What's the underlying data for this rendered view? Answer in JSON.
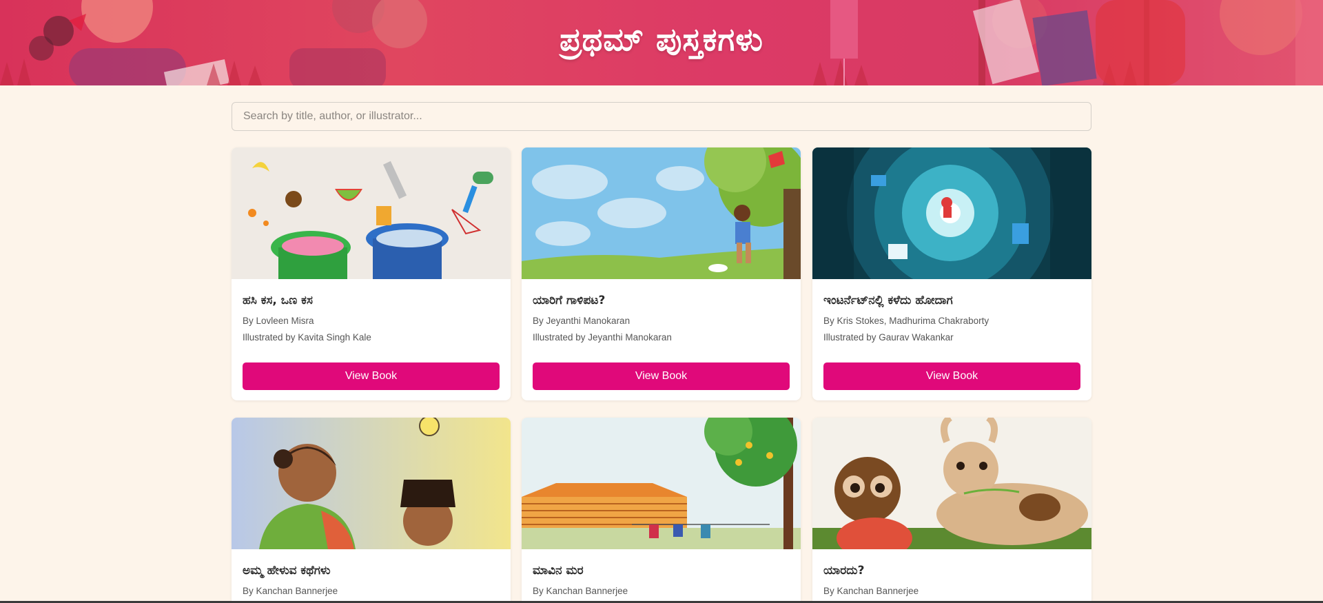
{
  "header": {
    "title": "ಪ್ರಥಮ್ ಪುಸ್ತಕಗಳು"
  },
  "search": {
    "placeholder": "Search by title, author, or illustrator..."
  },
  "books": [
    {
      "title": "ಹಸಿ ಕಸ, ಒಣ ಕಸ",
      "author": "By Lovleen Misra",
      "illustrator": "Illustrated by Kavita Singh Kale",
      "button": "View Book"
    },
    {
      "title": "ಯಾರಿಗೆ ಗಾಳಿಪಟ?",
      "author": "By Jeyanthi Manokaran",
      "illustrator": "Illustrated by Jeyanthi Manokaran",
      "button": "View Book"
    },
    {
      "title": "ಇಂಟರ್ನೆಟ್‌ನಲ್ಲಿ ಕಳೆದು ಹೋದಾಗ",
      "author": "By Kris Stokes, Madhurima Chakraborty",
      "illustrator": "Illustrated by Gaurav Wakankar",
      "button": "View Book"
    },
    {
      "title": "ಅಮ್ಮ ಹೇಳುವ ಕಥೆಗಳು",
      "author": "By Kanchan Bannerjee"
    },
    {
      "title": "ಮಾವಿನ ಮರ",
      "author": "By Kanchan Bannerjee"
    },
    {
      "title": "ಯಾರದು?",
      "author": "By Kanchan Bannerjee"
    }
  ],
  "colors": {
    "banner": "#d8325a",
    "button": "#e0097a",
    "background": "#fdf4ea"
  }
}
